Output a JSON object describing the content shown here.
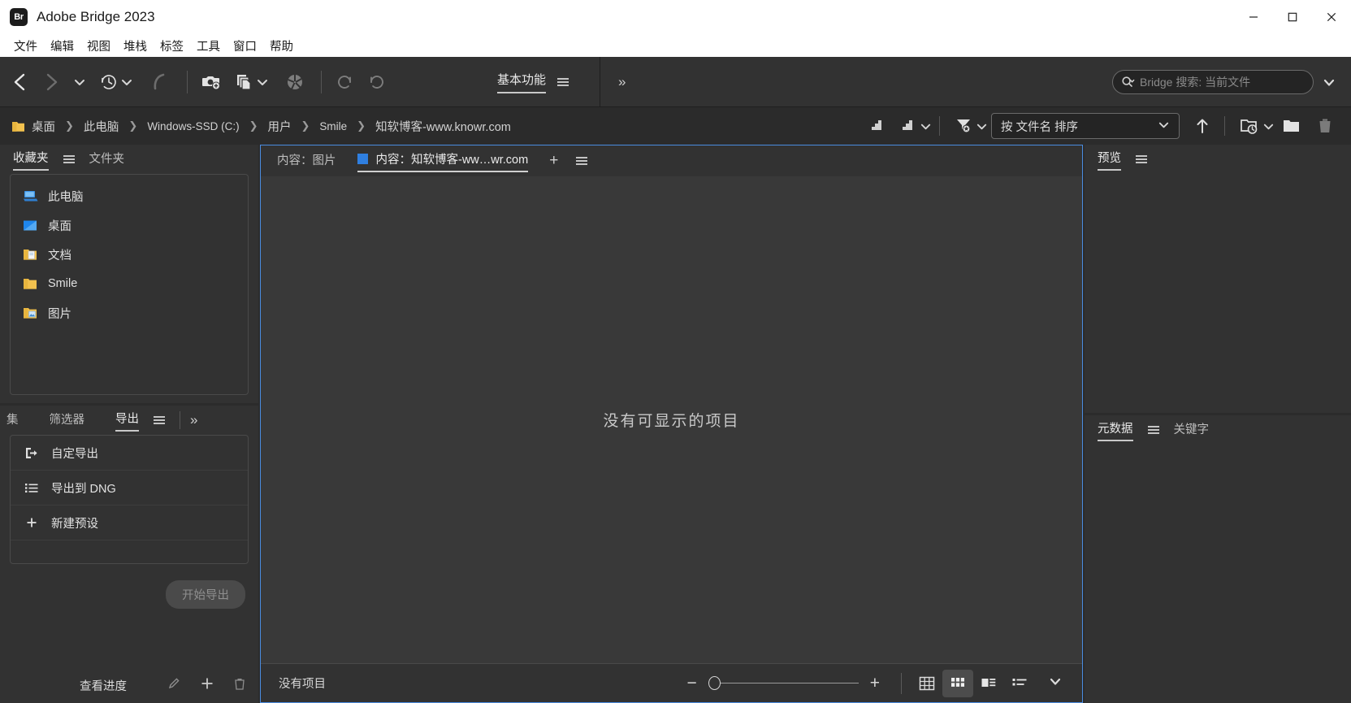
{
  "window": {
    "title": "Adobe Bridge 2023",
    "logo_text": "Br",
    "controls": {
      "minimize": "minimize-icon",
      "maximize": "maximize-icon",
      "close": "close-icon"
    }
  },
  "menubar": {
    "items": [
      "文件",
      "编辑",
      "视图",
      "堆栈",
      "标签",
      "工具",
      "窗口",
      "帮助"
    ]
  },
  "toolbar": {
    "nav_icons": [
      "back-arrow-icon",
      "forward-arrow-icon",
      "chevron-down-icon",
      "history-clock-icon",
      "history-chevron-icon",
      "refine-icon"
    ],
    "action_icons": [
      "get-photos-camera-icon",
      "batch-rename-copy-icon",
      "batch-chevron-icon",
      "camera-raw-aperture-icon",
      "rotate-counterclockwise-icon",
      "rotate-clockwise-icon"
    ],
    "workspace": {
      "label": "基本功能",
      "menu_icon": "hamburger-icon",
      "more_label": "»"
    },
    "search": {
      "placeholder": "Bridge 搜索: 当前文件",
      "icon": "search-icon",
      "dropdown_icon": "chevron-down-icon"
    }
  },
  "pathbar": {
    "crumbs": [
      {
        "label": "桌面",
        "icon": "folder-icon"
      },
      {
        "label": "此电脑"
      },
      {
        "label": "Windows-SSD (C:)"
      },
      {
        "label": "用户"
      },
      {
        "label": "Smile"
      },
      {
        "label": "知软博客-www.knowr.com"
      }
    ],
    "separator": "❯",
    "rating_icon": "rating-filter-icon",
    "rating_menu_icon": "rating-filter-chevron-icon",
    "filter_icon": "filter-funnel-icon",
    "sort": {
      "label": "按 文件名 排序",
      "chevron": "chevron-down-icon"
    },
    "up_icon": "up-arrow-icon",
    "recent_folder_icon": "recent-folder-icon",
    "new_folder_icon": "new-folder-icon",
    "delete_icon": "trash-icon"
  },
  "favorites_panel": {
    "tabs": [
      {
        "label": "收藏夹",
        "active": true
      },
      {
        "label": "文件夹",
        "active": false
      }
    ],
    "menu_icon": "hamburger-icon",
    "items": [
      {
        "label": "此电脑",
        "icon": "this-pc-icon"
      },
      {
        "label": "桌面",
        "icon": "desktop-icon"
      },
      {
        "label": "文档",
        "icon": "documents-folder-icon"
      },
      {
        "label": "Smile",
        "icon": "user-folder-icon"
      },
      {
        "label": "图片",
        "icon": "pictures-folder-icon"
      }
    ]
  },
  "export_panel": {
    "tabs": [
      {
        "label": "集",
        "active": false
      },
      {
        "label": "筛选器",
        "active": false
      },
      {
        "label": "导出",
        "active": true
      }
    ],
    "menu_icon": "hamburger-icon",
    "more_label": "»",
    "rows": [
      {
        "label": "自定导出",
        "icon": "export-arrow-icon"
      },
      {
        "label": "导出到 DNG",
        "icon": "list-icon"
      },
      {
        "label": "新建预设",
        "icon": "plus-icon"
      }
    ],
    "start_button": "开始导出",
    "progress_label": "查看进度",
    "progress_icons": [
      "pencil-icon",
      "plus-icon",
      "trash-icon"
    ]
  },
  "content_panel": {
    "tabs": [
      {
        "label": "内容：图片",
        "active": false,
        "marker": false
      },
      {
        "label": "内容：知软博客-ww…wr.com",
        "active": true,
        "marker": true
      }
    ],
    "add_tab_label": "+",
    "menu_icon": "hamburger-icon",
    "empty_message": "没有可显示的项目",
    "status": {
      "items_text": "没有项目",
      "zoom_out": "−",
      "zoom_in": "+",
      "thumbnail_slider_value": 0,
      "view_modes": [
        {
          "name": "lock-thumbnail-grid-icon",
          "active": false
        },
        {
          "name": "grid-view-icon",
          "active": true
        },
        {
          "name": "details-view-icon",
          "active": false
        },
        {
          "name": "list-view-icon",
          "active": false
        }
      ],
      "overflow_icon": "chevron-down-icon"
    }
  },
  "preview_panel": {
    "title": "预览",
    "menu_icon": "hamburger-icon"
  },
  "metadata_panel": {
    "tabs": [
      {
        "label": "元数据",
        "active": true
      },
      {
        "label": "关键字",
        "active": false
      }
    ],
    "menu_icon": "hamburger-icon"
  },
  "colors": {
    "accent_blue": "#4a8ce0",
    "tab_marker_blue": "#2f7fe0",
    "panel_bg": "#323232",
    "content_bg": "#393939",
    "app_bg": "#2b2b2b",
    "titlebar_bg": "#ffffff"
  }
}
